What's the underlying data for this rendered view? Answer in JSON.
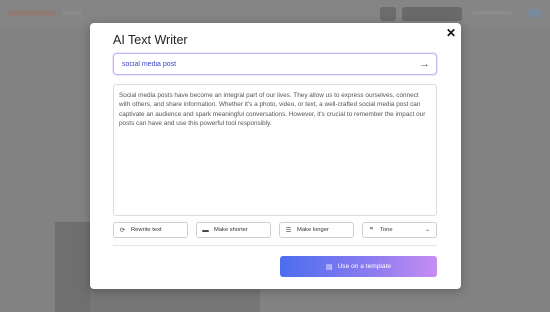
{
  "modal": {
    "title": "AI Text Writer",
    "close_symbol": "✕",
    "prompt_value": "social media post",
    "submit_icon": "arrow-right-icon",
    "generated_text": "Social media posts have become an integral part of our lives. They allow us to express ourselves, connect with others, and share information. Whether it's a photo, video, or text, a well-crafted social media post can captivate an audience and spark meaningful conversations. However, it's crucial to remember the impact our posts can have and use this powerful tool responsibly.",
    "actions": {
      "rewrite": "Rewrite text",
      "shorter": "Make shorter",
      "longer": "Make longer",
      "tone": "Tone"
    },
    "template_button": "Use on a template"
  },
  "colors": {
    "accent_start": "#4b6ef0",
    "accent_end": "#c68df2",
    "prompt_text": "#3a45c7"
  }
}
